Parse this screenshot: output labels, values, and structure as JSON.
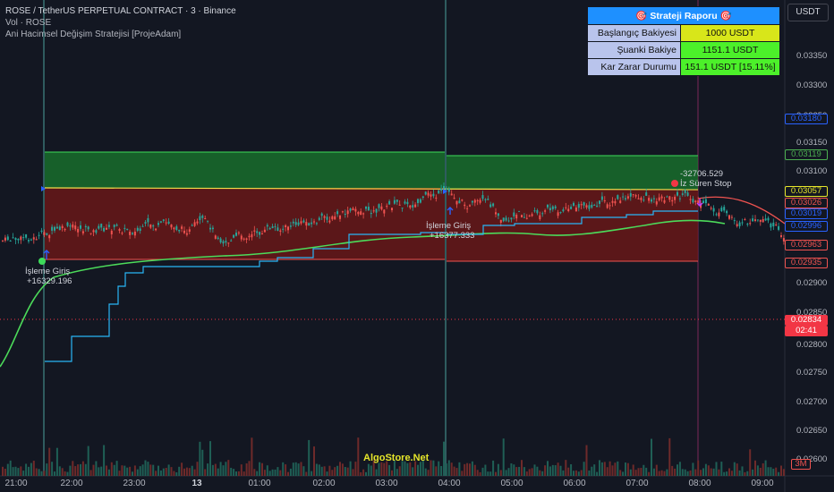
{
  "header": {
    "title": "ROSE / TetherUS PERPETUAL CONTRACT · 3 · Binance",
    "volume": "Vol · ROSE",
    "strategy": "Ani Hacimsel Değişim Stratejisi [ProjeAdam]"
  },
  "symbol_button": "USDT",
  "report": {
    "title": "🎯 Strateji Raporu 🎯",
    "rows": [
      {
        "label": "Başlangıç Bakiyesi",
        "value": "1000 USDT"
      },
      {
        "label": "Şuanki Bakiye",
        "value": "1151.1 USDT"
      },
      {
        "label": "Kar Zarar Durumu",
        "value": "151.1 USDT [15.11%]"
      }
    ]
  },
  "price_axis": {
    "labels": [
      "0.03350",
      "0.03300",
      "0.03250",
      "0.03150",
      "0.03100",
      "0.02900",
      "0.02850",
      "0.02800",
      "0.02750",
      "0.02700",
      "0.02650",
      "0.02600"
    ],
    "tags": [
      {
        "value": "0.03180",
        "color": "#2962ff",
        "bg": "#131722",
        "style": "outline"
      },
      {
        "value": "0.03119",
        "color": "#4caf50",
        "bg": "#131722",
        "style": "outline"
      },
      {
        "value": "0.03057",
        "color": "#e6e62a",
        "bg": "#131722",
        "style": "outline"
      },
      {
        "value": "0.03026",
        "color": "#ef5350",
        "bg": "#131722",
        "style": "outline"
      },
      {
        "value": "0.03019",
        "color": "#2962ff",
        "bg": "#131722",
        "style": "outline"
      },
      {
        "value": "0.02996",
        "color": "#2962ff",
        "bg": "#131722",
        "style": "outline"
      },
      {
        "value": "0.02963",
        "color": "#ef5350",
        "bg": "#131722",
        "style": "outline"
      },
      {
        "value": "0.02935",
        "color": "#ef5350",
        "bg": "#131722",
        "style": "outline"
      },
      {
        "value": "0.02834",
        "color": "#ffffff",
        "bg": "#f23645",
        "style": "fill"
      },
      {
        "value": "02:41",
        "color": "#ffffff",
        "bg": "#f23645",
        "style": "fill"
      },
      {
        "value": "3M",
        "color": "#ef5350",
        "bg": "#131722",
        "style": "outline"
      }
    ]
  },
  "time_axis": {
    "labels": [
      "21:00",
      "22:00",
      "23:00",
      "13",
      "01:00",
      "02:00",
      "03:00",
      "04:00",
      "05:00",
      "06:00",
      "07:00",
      "08:00",
      "09:00"
    ]
  },
  "annotations": {
    "entry1": "İşleme Giriş",
    "entry1_qty": "+16329.196",
    "entry2": "İşleme Giriş",
    "entry2_qty": "+16377.333",
    "exit_qty": "-32706.529",
    "exit_label": "İz Süren Stop"
  },
  "watermark": "AlgoStore.Net",
  "colors": {
    "background": "#131722",
    "up": "#ef5350",
    "down": "#ef5350",
    "profit_zone": "#1b7a2a",
    "loss_zone": "#7a1a1a",
    "trail": "#29b6f6",
    "ma": "#4cdb5a",
    "accent": "#1e90ff"
  }
}
